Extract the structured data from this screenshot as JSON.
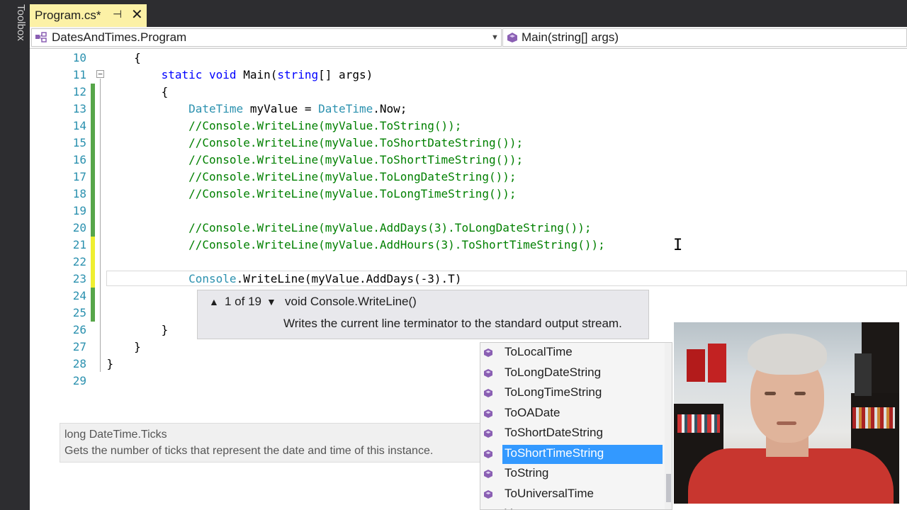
{
  "toolbox": {
    "label": "Toolbox"
  },
  "tab": {
    "title": "Program.cs*",
    "pin_icon": "pin-icon",
    "close_icon": "close-icon"
  },
  "nav": {
    "left": "DatesAndTimes.Program",
    "right": "Main(string[] args)"
  },
  "editor": {
    "lines": [
      {
        "n": "10",
        "change": "none",
        "code": [
          {
            "t": "        {",
            "c": ""
          }
        ]
      },
      {
        "n": "11",
        "change": "none",
        "code": [
          {
            "t": "            ",
            "c": ""
          },
          {
            "t": "static",
            "c": "kw"
          },
          {
            "t": " ",
            "c": ""
          },
          {
            "t": "void",
            "c": "kw"
          },
          {
            "t": " Main(",
            "c": ""
          },
          {
            "t": "string",
            "c": "kw"
          },
          {
            "t": "[] args)",
            "c": ""
          }
        ]
      },
      {
        "n": "12",
        "change": "saved",
        "code": [
          {
            "t": "            {",
            "c": ""
          }
        ]
      },
      {
        "n": "13",
        "change": "saved",
        "code": [
          {
            "t": "                ",
            "c": ""
          },
          {
            "t": "DateTime",
            "c": "ty"
          },
          {
            "t": " myValue = ",
            "c": ""
          },
          {
            "t": "DateTime",
            "c": "ty"
          },
          {
            "t": ".Now;",
            "c": ""
          }
        ]
      },
      {
        "n": "14",
        "change": "saved",
        "code": [
          {
            "t": "                ",
            "c": ""
          },
          {
            "t": "//Console.WriteLine(myValue.ToString());",
            "c": "cm"
          }
        ]
      },
      {
        "n": "15",
        "change": "saved",
        "code": [
          {
            "t": "                ",
            "c": ""
          },
          {
            "t": "//Console.WriteLine(myValue.ToShortDateString());",
            "c": "cm"
          }
        ]
      },
      {
        "n": "16",
        "change": "saved",
        "code": [
          {
            "t": "                ",
            "c": ""
          },
          {
            "t": "//Console.WriteLine(myValue.ToShortTimeString());",
            "c": "cm"
          }
        ]
      },
      {
        "n": "17",
        "change": "saved",
        "code": [
          {
            "t": "                ",
            "c": ""
          },
          {
            "t": "//Console.WriteLine(myValue.ToLongDateString());",
            "c": "cm"
          }
        ]
      },
      {
        "n": "18",
        "change": "saved",
        "code": [
          {
            "t": "                ",
            "c": ""
          },
          {
            "t": "//Console.WriteLine(myValue.ToLongTimeString());",
            "c": "cm"
          }
        ]
      },
      {
        "n": "19",
        "change": "saved",
        "code": [
          {
            "t": "",
            "c": ""
          }
        ]
      },
      {
        "n": "20",
        "change": "saved",
        "code": [
          {
            "t": "                ",
            "c": ""
          },
          {
            "t": "//Console.WriteLine(myValue.AddDays(3).ToLongDateString());",
            "c": "cm"
          }
        ]
      },
      {
        "n": "21",
        "change": "unsaved",
        "code": [
          {
            "t": "                ",
            "c": ""
          },
          {
            "t": "//Console.WriteLine(myValue.AddHours(3).ToShortTimeString());",
            "c": "cm"
          }
        ]
      },
      {
        "n": "22",
        "change": "unsaved",
        "code": [
          {
            "t": "",
            "c": ""
          }
        ]
      },
      {
        "n": "23",
        "change": "unsaved",
        "code": [
          {
            "t": "                ",
            "c": ""
          },
          {
            "t": "Console",
            "c": "ty"
          },
          {
            "t": ".WriteLine(myValue.AddDays(-3).T)",
            "c": ""
          }
        ]
      },
      {
        "n": "24",
        "change": "saved",
        "code": [
          {
            "t": "",
            "c": ""
          }
        ]
      },
      {
        "n": "25",
        "change": "saved",
        "code": [
          {
            "t": "",
            "c": ""
          }
        ]
      },
      {
        "n": "26",
        "change": "none",
        "code": [
          {
            "t": "            }",
            "c": ""
          }
        ]
      },
      {
        "n": "27",
        "change": "none",
        "code": [
          {
            "t": "        }",
            "c": ""
          }
        ]
      },
      {
        "n": "28",
        "change": "none",
        "code": [
          {
            "t": "    }",
            "c": ""
          }
        ]
      },
      {
        "n": "29",
        "change": "none",
        "code": [
          {
            "t": "",
            "c": ""
          }
        ]
      }
    ],
    "change_colors": {
      "saved": "#57a64a",
      "unsaved": "#efef30"
    }
  },
  "signature_tip": {
    "count": "1 of 19",
    "name": "void Console.WriteLine()",
    "description": "Writes the current line terminator to the standard output stream."
  },
  "quick_info": {
    "title": "long DateTime.Ticks",
    "description": "Gets the number of ticks that represent the date and time of this instance."
  },
  "completion": {
    "items": [
      "ToLocalTime",
      "ToLongDateString",
      "ToLongTimeString",
      "ToOADate",
      "ToShortDateString",
      "ToShortTimeString",
      "ToString",
      "ToUniversalTime",
      "Year"
    ],
    "selected": "ToShortTimeString",
    "icon": "method-icon"
  },
  "webcam": {
    "subject": "presenter-video"
  },
  "colors": {
    "tab_active": "#fcf1a6",
    "selection": "#3399ff",
    "line_number": "#2b91af",
    "comment": "#008000",
    "keyword": "#0000ff",
    "type": "#2b91af"
  }
}
